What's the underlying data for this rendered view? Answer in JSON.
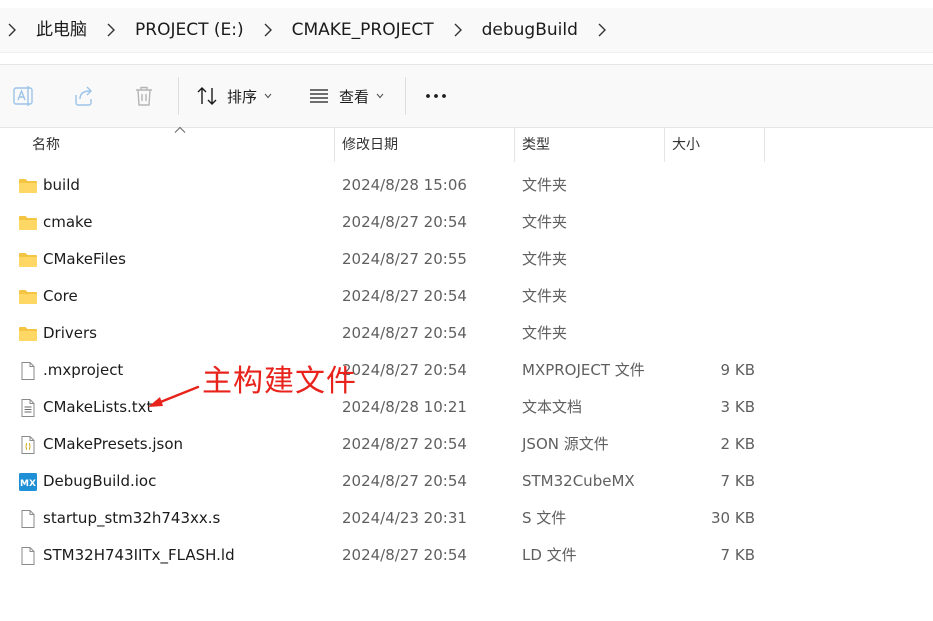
{
  "breadcrumb": {
    "items": [
      "此电脑",
      "PROJECT (E:)",
      "CMAKE_PROJECT",
      "debugBuild"
    ]
  },
  "toolbar": {
    "sort_label": "排序",
    "view_label": "查看",
    "more_label": "..."
  },
  "columns": {
    "name": "名称",
    "date": "修改日期",
    "type": "类型",
    "size": "大小"
  },
  "files": [
    {
      "name": "build",
      "date": "2024/8/28 15:06",
      "type": "文件夹",
      "size": "",
      "icon": "folder-icon"
    },
    {
      "name": "cmake",
      "date": "2024/8/27 20:54",
      "type": "文件夹",
      "size": "",
      "icon": "folder-icon"
    },
    {
      "name": "CMakeFiles",
      "date": "2024/8/27 20:55",
      "type": "文件夹",
      "size": "",
      "icon": "folder-icon"
    },
    {
      "name": "Core",
      "date": "2024/8/27 20:54",
      "type": "文件夹",
      "size": "",
      "icon": "folder-icon"
    },
    {
      "name": "Drivers",
      "date": "2024/8/27 20:54",
      "type": "文件夹",
      "size": "",
      "icon": "folder-icon"
    },
    {
      "name": ".mxproject",
      "date": "2024/8/27 20:54",
      "type": "MXPROJECT 文件",
      "size": "9 KB",
      "icon": "file-icon"
    },
    {
      "name": "CMakeLists.txt",
      "date": "2024/8/28 10:21",
      "type": "文本文档",
      "size": "3 KB",
      "icon": "text-file-icon"
    },
    {
      "name": "CMakePresets.json",
      "date": "2024/8/27 20:54",
      "type": "JSON 源文件",
      "size": "2 KB",
      "icon": "json-file-icon"
    },
    {
      "name": "DebugBuild.ioc",
      "date": "2024/8/27 20:54",
      "type": "STM32CubeMX",
      "size": "7 KB",
      "icon": "mx-file-icon"
    },
    {
      "name": "startup_stm32h743xx.s",
      "date": "2024/4/23 20:31",
      "type": "S 文件",
      "size": "30 KB",
      "icon": "file-icon"
    },
    {
      "name": "STM32H743IITx_FLASH.ld",
      "date": "2024/8/27 20:54",
      "type": "LD 文件",
      "size": "7 KB",
      "icon": "file-icon"
    }
  ],
  "annotation": {
    "text": "主构建文件",
    "color": "#e8231c"
  },
  "colors": {
    "folder": "#f4c542",
    "mx_badge": "#1f8fd6",
    "accent": "#0067c0"
  }
}
